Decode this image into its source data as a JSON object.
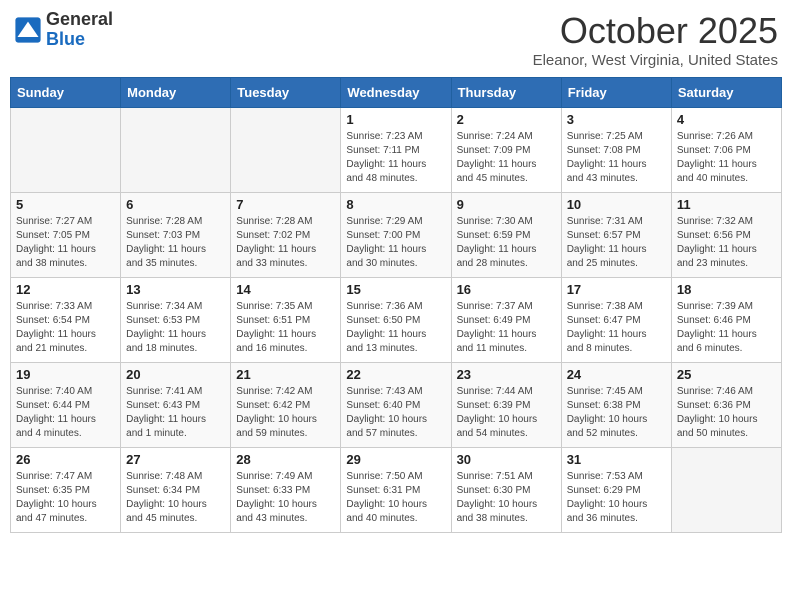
{
  "header": {
    "logo_line1": "General",
    "logo_line2": "Blue",
    "month_title": "October 2025",
    "location": "Eleanor, West Virginia, United States"
  },
  "days_of_week": [
    "Sunday",
    "Monday",
    "Tuesday",
    "Wednesday",
    "Thursday",
    "Friday",
    "Saturday"
  ],
  "weeks": [
    [
      {
        "day": "",
        "empty": true
      },
      {
        "day": "",
        "empty": true
      },
      {
        "day": "",
        "empty": true
      },
      {
        "day": "1",
        "sunrise": "7:23 AM",
        "sunset": "7:11 PM",
        "daylight": "11 hours and 48 minutes."
      },
      {
        "day": "2",
        "sunrise": "7:24 AM",
        "sunset": "7:09 PM",
        "daylight": "11 hours and 45 minutes."
      },
      {
        "day": "3",
        "sunrise": "7:25 AM",
        "sunset": "7:08 PM",
        "daylight": "11 hours and 43 minutes."
      },
      {
        "day": "4",
        "sunrise": "7:26 AM",
        "sunset": "7:06 PM",
        "daylight": "11 hours and 40 minutes."
      }
    ],
    [
      {
        "day": "5",
        "sunrise": "7:27 AM",
        "sunset": "7:05 PM",
        "daylight": "11 hours and 38 minutes."
      },
      {
        "day": "6",
        "sunrise": "7:28 AM",
        "sunset": "7:03 PM",
        "daylight": "11 hours and 35 minutes."
      },
      {
        "day": "7",
        "sunrise": "7:28 AM",
        "sunset": "7:02 PM",
        "daylight": "11 hours and 33 minutes."
      },
      {
        "day": "8",
        "sunrise": "7:29 AM",
        "sunset": "7:00 PM",
        "daylight": "11 hours and 30 minutes."
      },
      {
        "day": "9",
        "sunrise": "7:30 AM",
        "sunset": "6:59 PM",
        "daylight": "11 hours and 28 minutes."
      },
      {
        "day": "10",
        "sunrise": "7:31 AM",
        "sunset": "6:57 PM",
        "daylight": "11 hours and 25 minutes."
      },
      {
        "day": "11",
        "sunrise": "7:32 AM",
        "sunset": "6:56 PM",
        "daylight": "11 hours and 23 minutes."
      }
    ],
    [
      {
        "day": "12",
        "sunrise": "7:33 AM",
        "sunset": "6:54 PM",
        "daylight": "11 hours and 21 minutes."
      },
      {
        "day": "13",
        "sunrise": "7:34 AM",
        "sunset": "6:53 PM",
        "daylight": "11 hours and 18 minutes."
      },
      {
        "day": "14",
        "sunrise": "7:35 AM",
        "sunset": "6:51 PM",
        "daylight": "11 hours and 16 minutes."
      },
      {
        "day": "15",
        "sunrise": "7:36 AM",
        "sunset": "6:50 PM",
        "daylight": "11 hours and 13 minutes."
      },
      {
        "day": "16",
        "sunrise": "7:37 AM",
        "sunset": "6:49 PM",
        "daylight": "11 hours and 11 minutes."
      },
      {
        "day": "17",
        "sunrise": "7:38 AM",
        "sunset": "6:47 PM",
        "daylight": "11 hours and 8 minutes."
      },
      {
        "day": "18",
        "sunrise": "7:39 AM",
        "sunset": "6:46 PM",
        "daylight": "11 hours and 6 minutes."
      }
    ],
    [
      {
        "day": "19",
        "sunrise": "7:40 AM",
        "sunset": "6:44 PM",
        "daylight": "11 hours and 4 minutes."
      },
      {
        "day": "20",
        "sunrise": "7:41 AM",
        "sunset": "6:43 PM",
        "daylight": "11 hours and 1 minute."
      },
      {
        "day": "21",
        "sunrise": "7:42 AM",
        "sunset": "6:42 PM",
        "daylight": "10 hours and 59 minutes."
      },
      {
        "day": "22",
        "sunrise": "7:43 AM",
        "sunset": "6:40 PM",
        "daylight": "10 hours and 57 minutes."
      },
      {
        "day": "23",
        "sunrise": "7:44 AM",
        "sunset": "6:39 PM",
        "daylight": "10 hours and 54 minutes."
      },
      {
        "day": "24",
        "sunrise": "7:45 AM",
        "sunset": "6:38 PM",
        "daylight": "10 hours and 52 minutes."
      },
      {
        "day": "25",
        "sunrise": "7:46 AM",
        "sunset": "6:36 PM",
        "daylight": "10 hours and 50 minutes."
      }
    ],
    [
      {
        "day": "26",
        "sunrise": "7:47 AM",
        "sunset": "6:35 PM",
        "daylight": "10 hours and 47 minutes."
      },
      {
        "day": "27",
        "sunrise": "7:48 AM",
        "sunset": "6:34 PM",
        "daylight": "10 hours and 45 minutes."
      },
      {
        "day": "28",
        "sunrise": "7:49 AM",
        "sunset": "6:33 PM",
        "daylight": "10 hours and 43 minutes."
      },
      {
        "day": "29",
        "sunrise": "7:50 AM",
        "sunset": "6:31 PM",
        "daylight": "10 hours and 40 minutes."
      },
      {
        "day": "30",
        "sunrise": "7:51 AM",
        "sunset": "6:30 PM",
        "daylight": "10 hours and 38 minutes."
      },
      {
        "day": "31",
        "sunrise": "7:53 AM",
        "sunset": "6:29 PM",
        "daylight": "10 hours and 36 minutes."
      },
      {
        "day": "",
        "empty": true
      }
    ]
  ]
}
